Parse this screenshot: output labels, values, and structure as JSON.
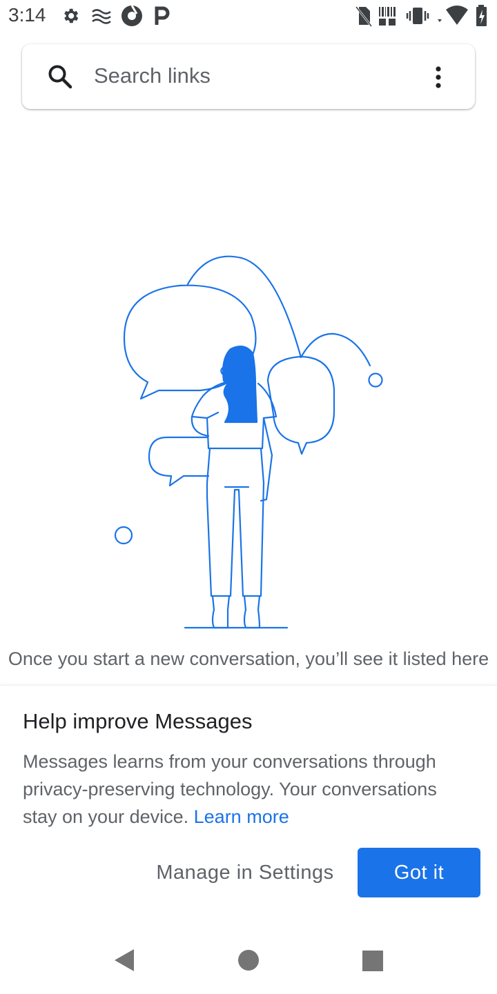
{
  "status_bar": {
    "time": "3:14",
    "left_icons": [
      "gear-icon",
      "waves-icon",
      "browser-icon",
      "p-app-icon"
    ],
    "right_icons": [
      "no-sim-icon",
      "barcode-icon",
      "vibrate-icon",
      "wifi-icon",
      "battery-icon"
    ]
  },
  "search": {
    "placeholder": "Search links"
  },
  "empty_state": {
    "message": "Once you start a new conversation, you’ll see it listed here"
  },
  "sheet": {
    "title": "Help improve Messages",
    "body": "Messages learns from your conversations through privacy-preserving technology. Your conversations stay on your device. ",
    "learn_more": "Learn more",
    "manage_button": "Manage in Settings",
    "got_it_button": "Got it"
  },
  "nav": {
    "items": [
      "back-icon",
      "home-icon",
      "recents-icon"
    ]
  },
  "colors": {
    "accent": "#1a73e8",
    "illustration": "#1a73e8"
  }
}
